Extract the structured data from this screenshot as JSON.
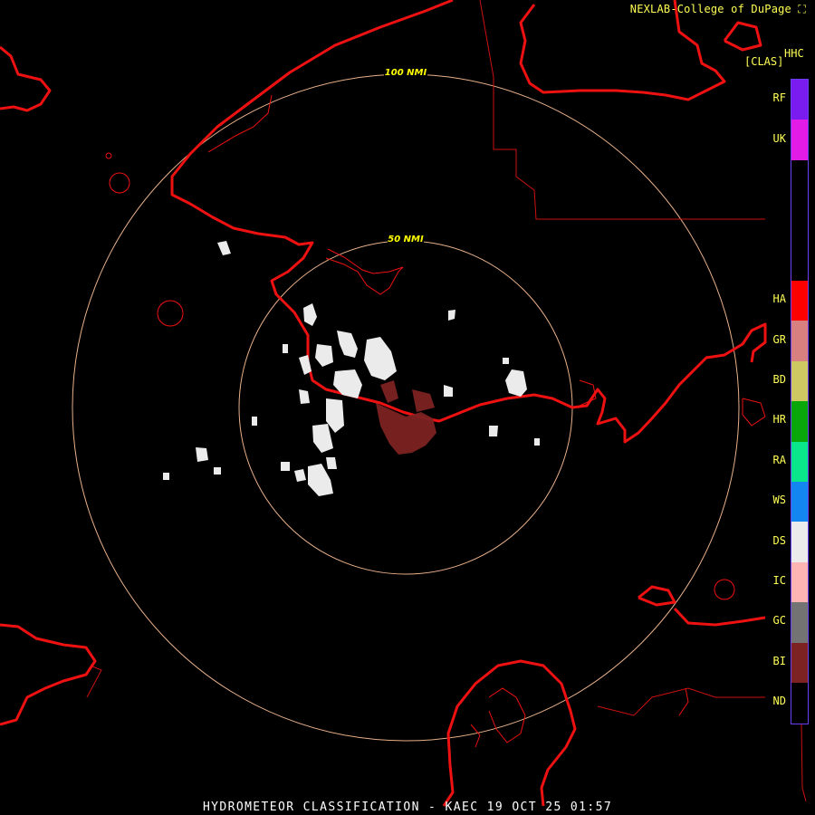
{
  "credit": "NEXLAB-College of DuPage ⛶",
  "product_code": "HHC",
  "unit": "[CLAS]",
  "rings": [
    {
      "label": "50 NMI",
      "radius_nmi": 50
    },
    {
      "label": "100 NMI",
      "radius_nmi": 100
    }
  ],
  "legend": [
    {
      "code": "RF",
      "color": "#7a1cf0"
    },
    {
      "code": "UK",
      "color": "#e21ce6"
    },
    {
      "code": "",
      "color": "#000000"
    },
    {
      "code": "",
      "color": "#000000"
    },
    {
      "code": "",
      "color": "#000000"
    },
    {
      "code": "HA",
      "color": "#ff0000"
    },
    {
      "code": "GR",
      "color": "#d88080"
    },
    {
      "code": "BD",
      "color": "#cdc862"
    },
    {
      "code": "HR",
      "color": "#0aa70a"
    },
    {
      "code": "RA",
      "color": "#0ae68a"
    },
    {
      "code": "WS",
      "color": "#1486f0"
    },
    {
      "code": "DS",
      "color": "#ebebeb"
    },
    {
      "code": "IC",
      "color": "#ffb4b4"
    },
    {
      "code": "GC",
      "color": "#737373"
    },
    {
      "code": "BI",
      "color": "#7d2222"
    },
    {
      "code": "ND",
      "color": "#000000"
    }
  ],
  "colors": {
    "coast": "#ee1111",
    "border": "#cc1111",
    "ring": "#e8b08a",
    "dry_snow": "#ebebeb",
    "biological": "#7d2222"
  },
  "footer": "HYDROMETEOR CLASSIFICATION - KAEC 19 OCT 25 01:57"
}
